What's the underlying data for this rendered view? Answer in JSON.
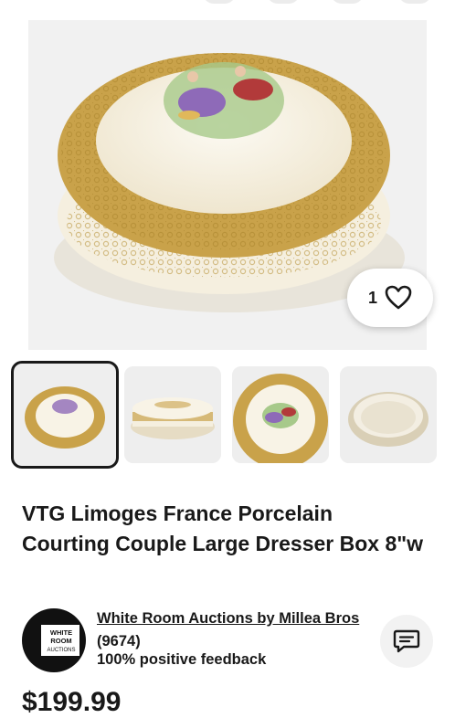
{
  "listing": {
    "title": "VTG Limoges France Porcelain Courting Couple Large Dresser Box 8\"w",
    "price": "$199.99",
    "watch_count": "1"
  },
  "gallery": {
    "thumbnails": [
      {
        "icon": "dresser-box-top-view",
        "selected": true
      },
      {
        "icon": "dresser-box-side-view",
        "selected": false
      },
      {
        "icon": "dresser-box-lid-closeup",
        "selected": false
      },
      {
        "icon": "dresser-box-base-interior",
        "selected": false
      }
    ]
  },
  "seller": {
    "name": "White Room Auctions by Millea Bros",
    "score": "(9674)",
    "feedback": "100% positive feedback",
    "logo_text": [
      "WHITE",
      "ROOM",
      "AUCTIONS"
    ]
  },
  "icons": {
    "watch": "heart-icon",
    "contact": "chat-icon"
  },
  "colors": {
    "text": "#191919",
    "gold": "#c9a24a",
    "porcelain": "#f8f3e6",
    "background": "#ffffff"
  }
}
